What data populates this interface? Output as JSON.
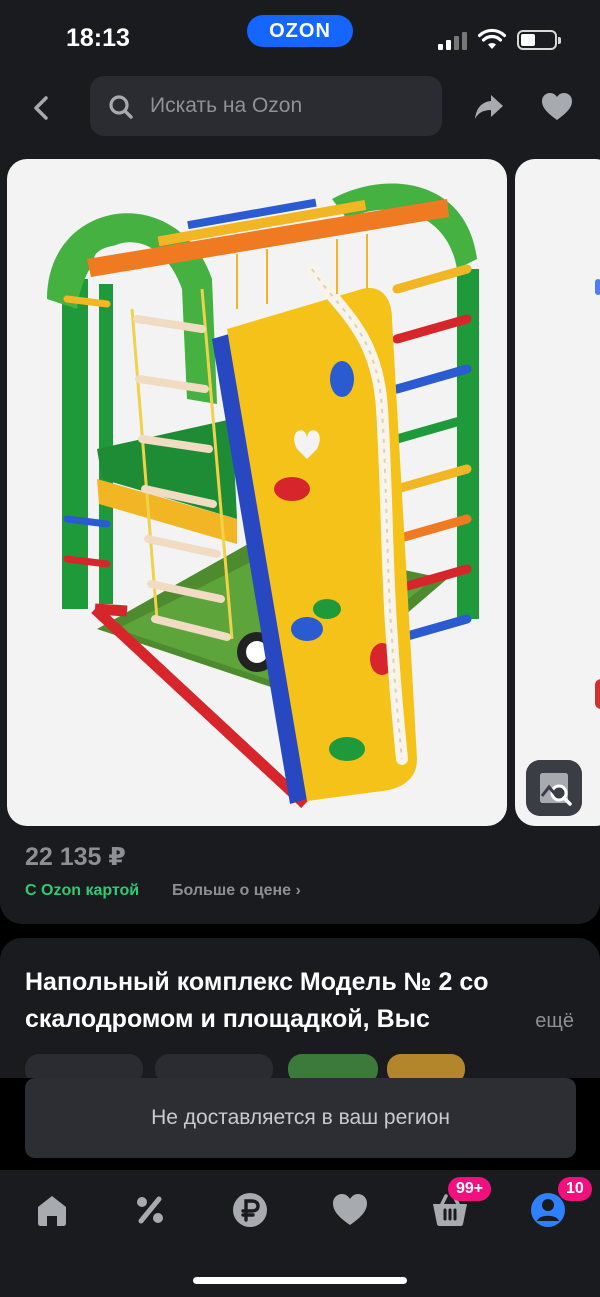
{
  "status_bar": {
    "time": "18:13",
    "brand": "OZON"
  },
  "search": {
    "placeholder": "Искать на Ozon"
  },
  "product": {
    "price": "22 135 ₽",
    "ozon_card_label": "С Ozon картой",
    "price_more_label": "Больше о цене",
    "title": "Напольный комплекс Модель № 2 со скалодромом и площадкой, Выс",
    "more_label": "ещё"
  },
  "notice": {
    "text": "Не доставляется в ваш регион"
  },
  "bottom_nav": {
    "cart_badge": "99+",
    "profile_badge": "10"
  },
  "colors": {
    "accent": "#1565ff",
    "ozon_card_green": "#2ecc71",
    "badge_pink": "#f1117e",
    "profile_blue": "#2f80ff",
    "background": "#1a1b1f"
  },
  "icons": [
    "back-icon",
    "search-icon",
    "share-icon",
    "heart-icon",
    "similar-search-icon",
    "home-icon",
    "percent-icon",
    "ruble-icon",
    "favorites-icon",
    "cart-icon",
    "profile-icon"
  ]
}
